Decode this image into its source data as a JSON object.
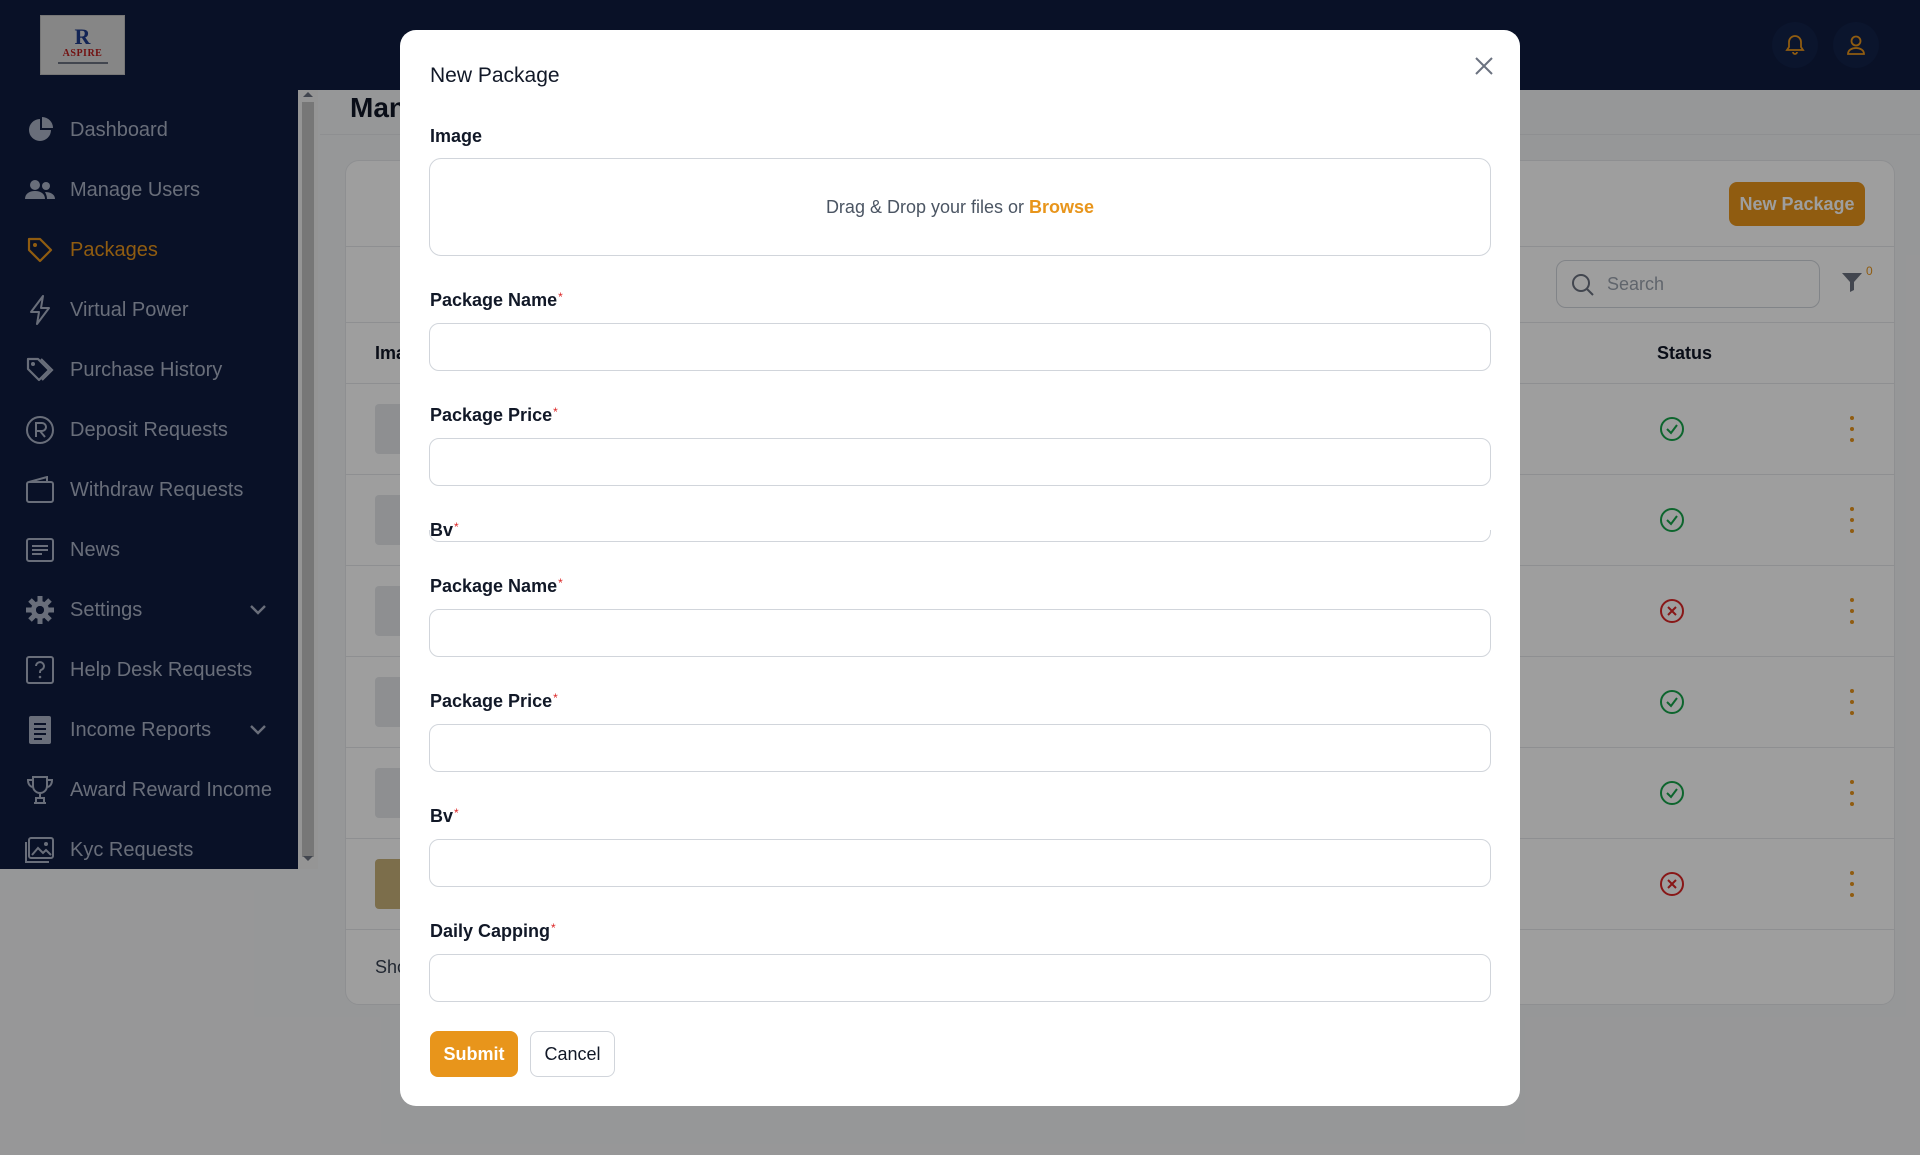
{
  "header": {
    "logo_mark": "R",
    "logo_brand": "ASPIRE",
    "notification_icon": "bell-icon",
    "profile_icon": "user-icon"
  },
  "sidebar": {
    "items": [
      {
        "label": "Dashboard",
        "icon": "pie-chart-icon"
      },
      {
        "label": "Manage Users",
        "icon": "users-icon"
      },
      {
        "label": "Packages",
        "icon": "tag-icon",
        "active": true
      },
      {
        "label": "Virtual Power",
        "icon": "lightning-icon"
      },
      {
        "label": "Purchase History",
        "icon": "tags-icon"
      },
      {
        "label": "Deposit Requests",
        "icon": "rupee-circle-icon"
      },
      {
        "label": "Withdraw Requests",
        "icon": "wallet-icon"
      },
      {
        "label": "News",
        "icon": "newspaper-icon"
      },
      {
        "label": "Settings",
        "icon": "gear-icon",
        "expandable": true
      },
      {
        "label": "Help Desk Requests",
        "icon": "question-square-icon"
      },
      {
        "label": "Income Reports",
        "icon": "document-icon",
        "expandable": true
      },
      {
        "label": "Award Reward Income",
        "icon": "trophy-icon"
      },
      {
        "label": "Kyc Requests",
        "icon": "image-icon"
      }
    ]
  },
  "page": {
    "title": "Man",
    "new_package_button": "New Package",
    "search_placeholder": "Search",
    "filter_count": "0",
    "table_header_image": "Ima",
    "table_header_status": "Status",
    "row_statuses": [
      "active",
      "active",
      "inactive",
      "active",
      "active",
      "inactive"
    ],
    "footer_text": "Sho"
  },
  "modal": {
    "title": "New Package",
    "image_label": "Image",
    "dropzone_text": "Drag & Drop your files or",
    "dropzone_link": "Browse",
    "fields": [
      {
        "label": "Package Name",
        "value": ""
      },
      {
        "label": "Package Price",
        "value": ""
      },
      {
        "label": "Bv",
        "value": ""
      },
      {
        "label": "Package Name",
        "value": ""
      },
      {
        "label": "Package Price",
        "value": ""
      },
      {
        "label": "Bv",
        "value": ""
      },
      {
        "label": "Daily Capping",
        "value": ""
      }
    ],
    "required_mark": "*",
    "submit_label": "Submit",
    "cancel_label": "Cancel"
  },
  "colors": {
    "accent": "#e8951b",
    "sidebar_bg": "#0f1c3f",
    "active_status": "#16a34a",
    "inactive_status": "#dc2626"
  }
}
